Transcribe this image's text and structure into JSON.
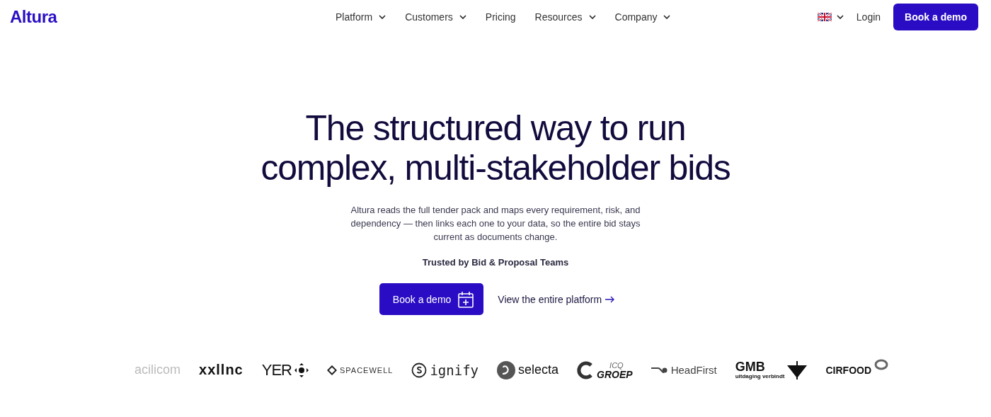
{
  "header": {
    "logo": "Altura",
    "nav": [
      {
        "label": "Platform",
        "dropdown": true
      },
      {
        "label": "Customers",
        "dropdown": true
      },
      {
        "label": "Pricing",
        "dropdown": false
      },
      {
        "label": "Resources",
        "dropdown": true
      },
      {
        "label": "Company",
        "dropdown": true
      }
    ],
    "login": "Login",
    "cta": "Book a demo"
  },
  "hero": {
    "title_lines": [
      "The structured way to run",
      "complex, multi-stakeholder bids"
    ],
    "subtitle": "Altura reads the full tender pack and maps every requirement, risk, and dependency — then links each one to your data, so the entire bid stays current as documents change.",
    "trusted": "Trusted by Bid & Proposal Teams",
    "primary": "Book a demo",
    "secondary": "View the entire platform"
  },
  "logos": [
    {
      "name": "acilicom",
      "kind": "faded"
    },
    {
      "name": "xxllnc",
      "kind": "bold"
    },
    {
      "name": "YER",
      "kind": "yer"
    },
    {
      "name": "SPACEWELL",
      "kind": "spacewell"
    },
    {
      "name": "ignify",
      "kind": "signify"
    },
    {
      "name": "selecta",
      "kind": "selecta"
    },
    {
      "name": "ICQ",
      "line2": "GROEP",
      "kind": "icq"
    },
    {
      "name": "HeadFirst",
      "kind": "headfirst"
    },
    {
      "name": "GMB",
      "line2": "uitdaging verbindt",
      "kind": "gmb"
    },
    {
      "name": "CIRFOOD",
      "kind": "cirfood"
    }
  ]
}
